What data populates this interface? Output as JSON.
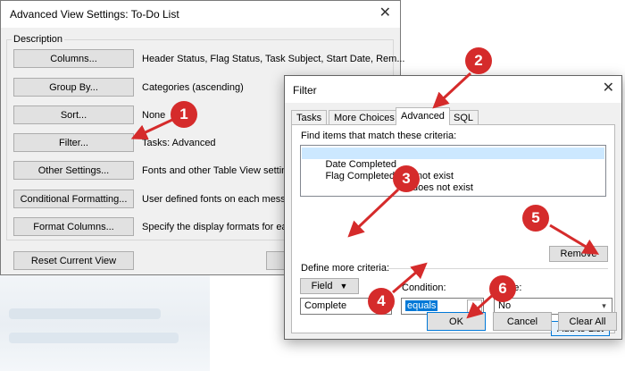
{
  "advanced_dialog": {
    "title": "Advanced View Settings: To-Do List",
    "group_label": "Description",
    "rows": [
      {
        "button": "Columns...",
        "desc": "Header Status, Flag Status, Task Subject, Start Date, Rem..."
      },
      {
        "button": "Group By...",
        "desc": "Categories (ascending)"
      },
      {
        "button": "Sort...",
        "desc": "None"
      },
      {
        "button": "Filter...",
        "desc": "Tasks: Advanced"
      },
      {
        "button": "Other Settings...",
        "desc": "Fonts and other Table View setting"
      },
      {
        "button": "Conditional Formatting...",
        "desc": "User defined fonts on each messa"
      },
      {
        "button": "Format Columns...",
        "desc": "Specify the display formats for eac"
      }
    ],
    "reset_button": "Reset Current View"
  },
  "filter_dialog": {
    "title": "Filter",
    "tabs": [
      "Tasks",
      "More Choices",
      "Advanced",
      "SQL"
    ],
    "active_tab": "Advanced",
    "criteria_label": "Find items that match these criteria:",
    "criteria": [
      {
        "field": "Date Completed",
        "condition": "does not exist"
      },
      {
        "field": "Flag Completed Date",
        "condition": "does not exist"
      }
    ],
    "remove_button": "Remove",
    "define_label": "Define more criteria:",
    "field_button": "Field",
    "field_value": "Complete",
    "condition_label": "Condition:",
    "condition_value": "equals",
    "value_label": "Value:",
    "value_value": "No",
    "add_button": "Add to List",
    "ok_button": "OK",
    "cancel_button": "Cancel",
    "clear_button": "Clear All"
  },
  "annotations": [
    "1",
    "2",
    "3",
    "4",
    "5",
    "6"
  ],
  "colors": {
    "annotation": "#d52b2b",
    "selection": "#cce8ff",
    "dialog_bg": "#f0f0f0",
    "focus_border": "#0078d7"
  }
}
